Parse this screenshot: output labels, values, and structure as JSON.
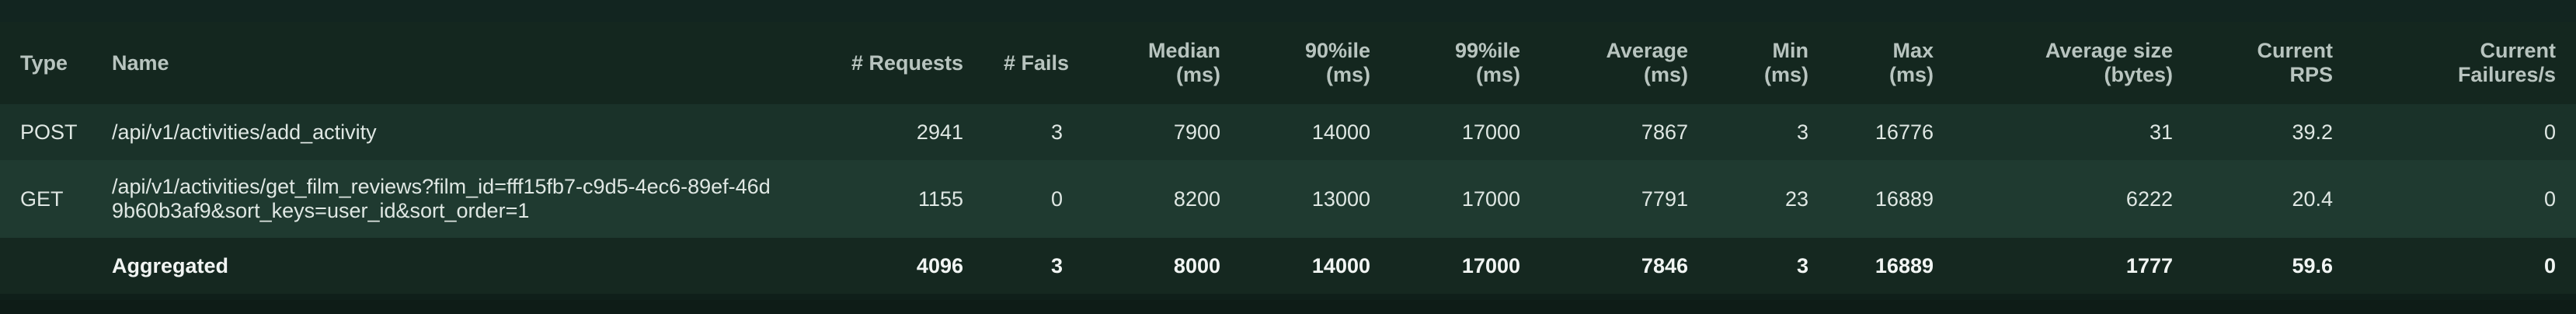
{
  "table": {
    "headers": {
      "type": "Type",
      "name": "Name",
      "requests": "# Requests",
      "fails": "# Fails",
      "median": [
        "Median",
        "(ms)"
      ],
      "p90": [
        "90%ile",
        "(ms)"
      ],
      "p99": [
        "99%ile",
        "(ms)"
      ],
      "average": [
        "Average",
        "(ms)"
      ],
      "min": [
        "Min",
        "(ms)"
      ],
      "max": [
        "Max",
        "(ms)"
      ],
      "avg_size": [
        "Average size",
        "(bytes)"
      ],
      "rps": [
        "Current",
        "RPS"
      ],
      "failures_s": [
        "Current",
        "Failures/s"
      ]
    },
    "rows": [
      {
        "type": "POST",
        "name": "/api/v1/activities/add_activity",
        "requests": "2941",
        "fails": "3",
        "median": "7900",
        "p90": "14000",
        "p99": "17000",
        "average": "7867",
        "min": "3",
        "max": "16776",
        "avg_size": "31",
        "rps": "39.2",
        "failures_s": "0"
      },
      {
        "type": "GET",
        "name": "/api/v1/activities/get_film_reviews?film_id=fff15fb7-c9d5-4ec6-89ef-46d9b60b3af9&sort_keys=user_id&sort_order=1",
        "requests": "1155",
        "fails": "0",
        "median": "8200",
        "p90": "13000",
        "p99": "17000",
        "average": "7791",
        "min": "23",
        "max": "16889",
        "avg_size": "6222",
        "rps": "20.4",
        "failures_s": "0"
      }
    ],
    "aggregated": {
      "type": "",
      "name": "Aggregated",
      "requests": "4096",
      "fails": "3",
      "median": "8000",
      "p90": "14000",
      "p99": "17000",
      "average": "7846",
      "min": "3",
      "max": "16889",
      "avg_size": "1777",
      "rps": "59.6",
      "failures_s": "0"
    }
  }
}
